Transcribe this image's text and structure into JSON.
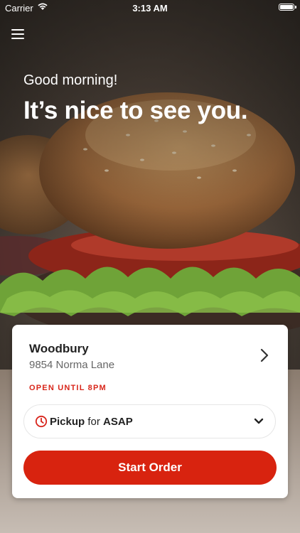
{
  "status_bar": {
    "carrier": "Carrier",
    "time": "3:13 AM"
  },
  "nav": {
    "menu_icon": "hamburger-menu-icon"
  },
  "hero": {
    "greeting": "Good morning!",
    "welcome": "It’s nice to see you."
  },
  "store": {
    "name": "Woodbury",
    "address": "9854 Norma Lane",
    "hours": "OPEN UNTIL 8PM"
  },
  "order_type": {
    "method": "Pickup",
    "connector": "for",
    "when": "ASAP",
    "icon": "clock-icon"
  },
  "cta": {
    "label": "Start Order"
  },
  "colors": {
    "accent": "#d8230f",
    "hours_text": "#d8261a"
  }
}
